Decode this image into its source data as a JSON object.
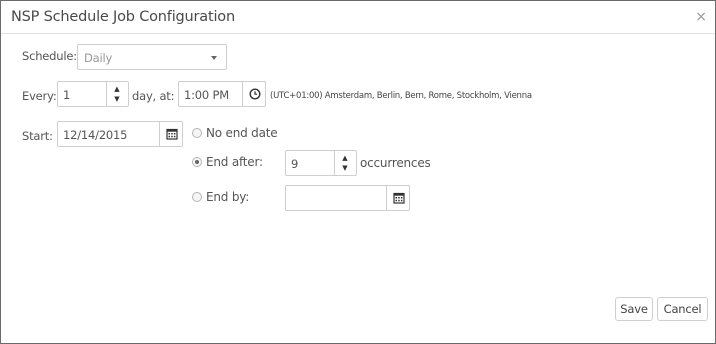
{
  "dialog": {
    "title": "NSP Schedule Job Configuration",
    "close_glyph": "×"
  },
  "schedule": {
    "label": "Schedule:",
    "value": "Daily"
  },
  "every": {
    "label": "Every:",
    "value": "1",
    "unit_label": "day, at:",
    "time_value": "1:00 PM",
    "timezone": "(UTC+01:00) Amsterdam, Berlin, Bern, Rome, Stockholm, Vienna"
  },
  "start": {
    "label": "Start:",
    "value": "12/14/2015"
  },
  "end_options": {
    "selected": "end_after",
    "no_end_date_label": "No end date",
    "end_after_label": "End after:",
    "occurrences_value": "9",
    "occurrences_label": "occurrences",
    "end_by_label": "End by:",
    "end_by_value": ""
  },
  "footer": {
    "save_label": "Save",
    "cancel_label": "Cancel"
  },
  "icons": {
    "spin_up": "▲",
    "spin_down": "▼",
    "clock": "clock-icon",
    "calendar": "calendar-icon",
    "dropdown": "chevron-down-icon"
  }
}
